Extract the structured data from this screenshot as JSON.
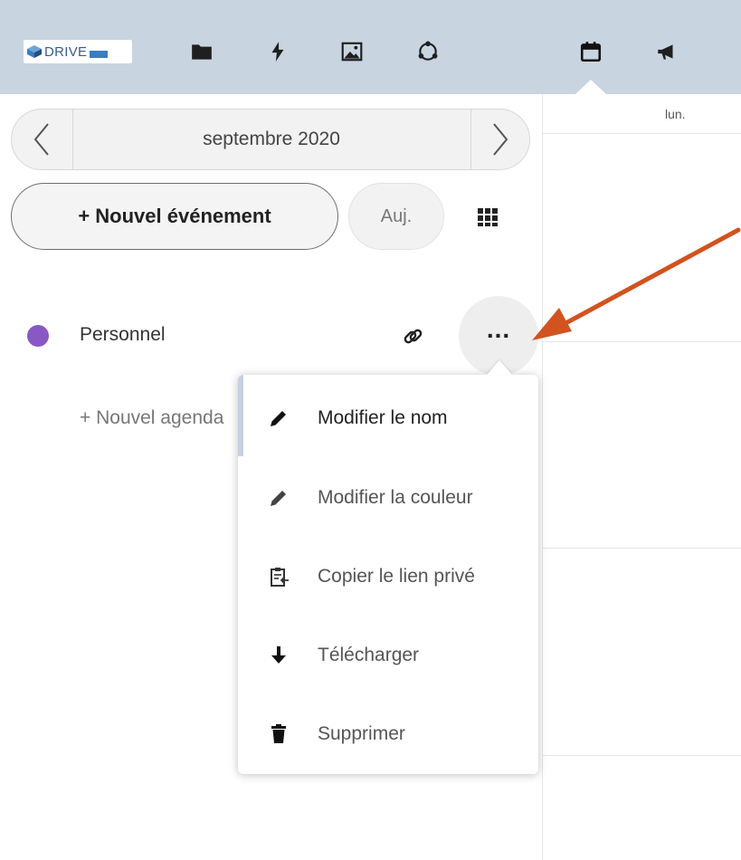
{
  "header": {
    "logo_text": "DRIVE",
    "icons": [
      "folder-icon",
      "activity-icon",
      "photos-icon",
      "circles-icon",
      "calendar-icon",
      "announcements-icon"
    ],
    "active_app": "calendar-icon"
  },
  "nav": {
    "month": "septembre 2020",
    "prev_icon": "chevron-left-icon",
    "next_icon": "chevron-right-icon"
  },
  "actions": {
    "new_event": "+ Nouvel événement",
    "today": "Auj."
  },
  "calendars": [
    {
      "name": "Personnel",
      "color": "#8a58c4"
    }
  ],
  "new_calendar": "+ Nouvel agenda",
  "calendar_menu": {
    "items": [
      {
        "label": "Modifier le nom",
        "icon": "pencil-icon"
      },
      {
        "label": "Modifier la couleur",
        "icon": "pencil-icon"
      },
      {
        "label": "Copier le lien privé",
        "icon": "clipboard-icon"
      },
      {
        "label": "Télécharger",
        "icon": "download-icon"
      },
      {
        "label": "Supprimer",
        "icon": "trash-icon"
      }
    ]
  },
  "view": {
    "day_header": "lun."
  },
  "colors": {
    "header_bg": "#c9d4e1",
    "annotation_arrow": "#d2531f"
  }
}
